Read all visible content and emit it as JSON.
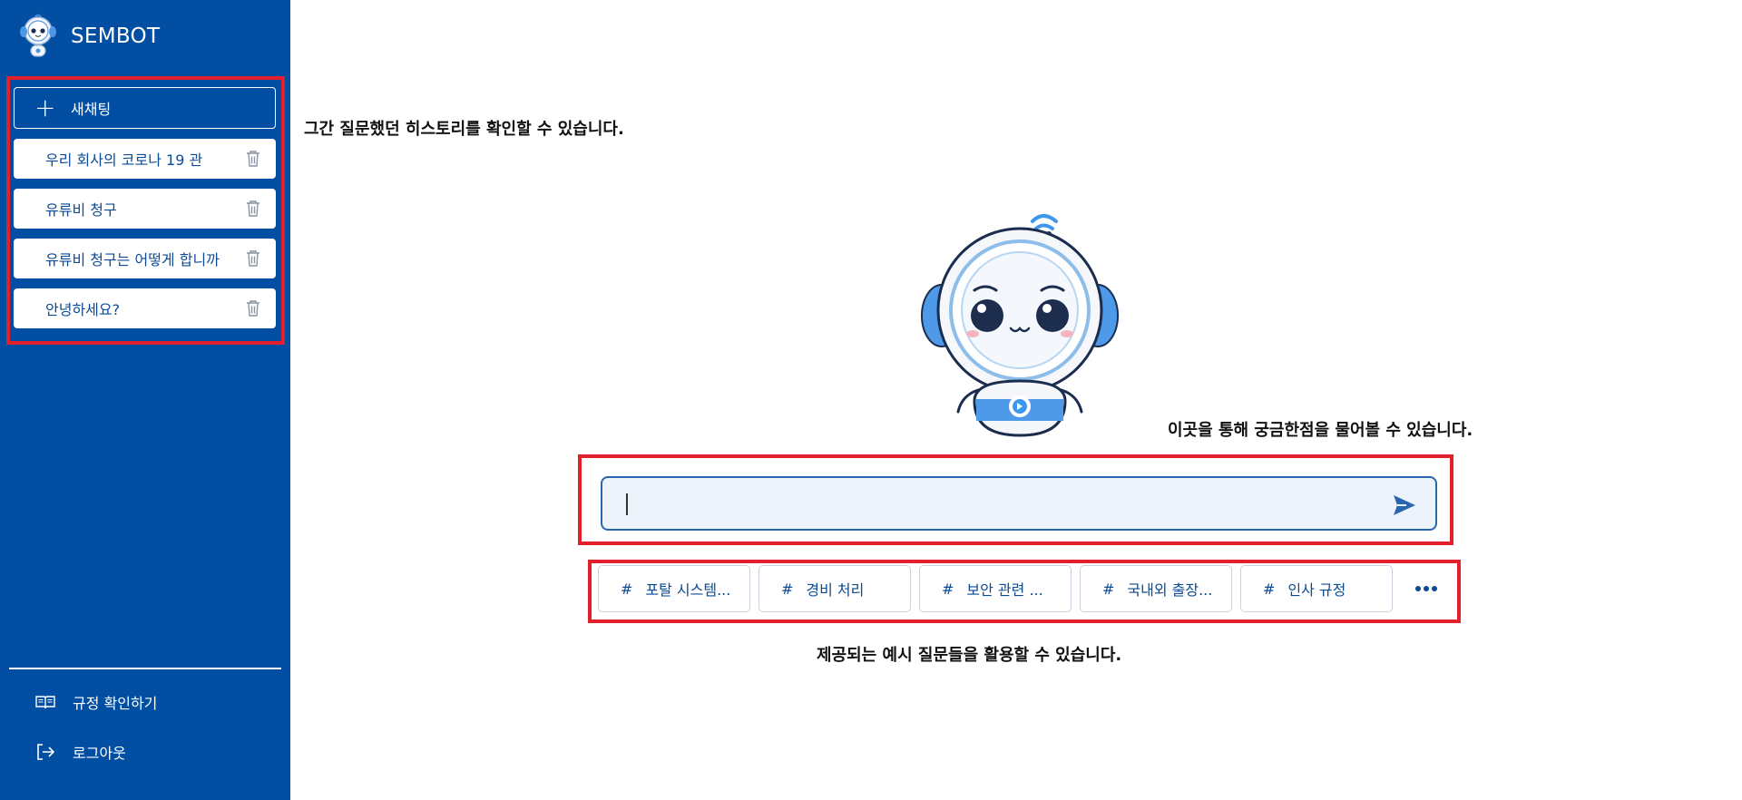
{
  "app": {
    "name": "SEMBOT"
  },
  "sidebar": {
    "new_chat_label": "새채팅",
    "history": [
      {
        "title": "우리 회사의 코로나 19 관"
      },
      {
        "title": "유류비 청구"
      },
      {
        "title": "유류비 청구는 어떻게 합니까"
      },
      {
        "title": "안녕하세요?"
      }
    ],
    "footer": {
      "rules_label": "규정 확인하기",
      "logout_label": "로그아웃"
    }
  },
  "annotations": {
    "history_note": "그간 질문했던 히스토리를 확인할 수 있습니다.",
    "input_note": "이곳을 통해 궁금한점을 물어볼 수 있습니다.",
    "chips_note": "제공되는 예시 질문들을 활용할 수 있습니다."
  },
  "chat": {
    "input_value": "",
    "input_placeholder": ""
  },
  "suggestions": {
    "hash": "#",
    "items": [
      "포탈 시스템...",
      "경비 처리",
      "보안 관련 ...",
      "국내외 출장...",
      "인사 규정"
    ]
  },
  "colors": {
    "sidebar_bg": "#024ea2",
    "highlight_red": "#e2202b",
    "accent_blue": "#0b4a95",
    "input_bg": "#edf3fb"
  },
  "icons": {
    "logo": "robot-logo-icon",
    "new_chat": "plus-icon",
    "delete": "trash-icon",
    "rules": "book-icon",
    "logout": "logout-icon",
    "send": "send-icon",
    "more": "more-dots-icon"
  }
}
